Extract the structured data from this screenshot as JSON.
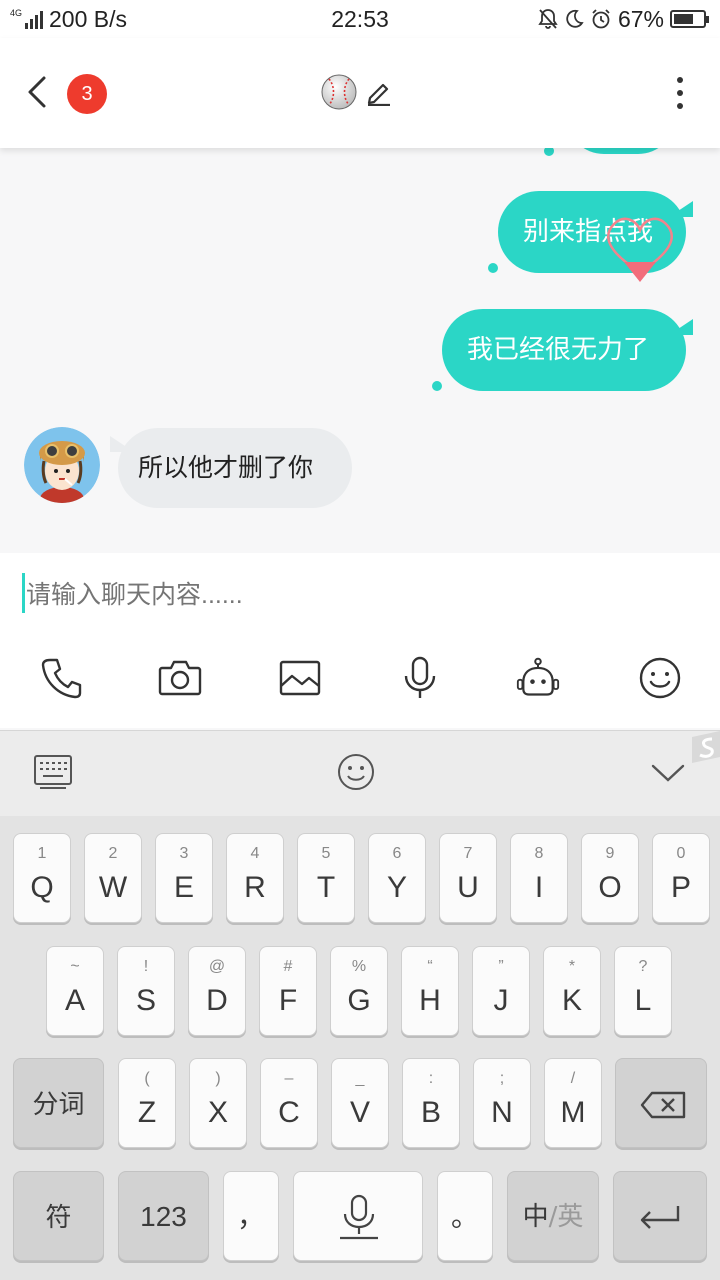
{
  "status_bar": {
    "network": "4G",
    "speed": "200 B/s",
    "time": "22:53",
    "battery": "67%",
    "battery_level": 0.67
  },
  "header": {
    "unread_count": "3"
  },
  "messages": [
    {
      "side": "out",
      "text": "别来指点我"
    },
    {
      "side": "out",
      "text": "我已经很无力了"
    },
    {
      "side": "in",
      "text": "所以他才删了你"
    }
  ],
  "input": {
    "placeholder": "请输入聊天内容......"
  },
  "toolbar": [
    "phone-icon",
    "camera-icon",
    "image-icon",
    "microphone-icon",
    "robot-icon",
    "emoji-icon"
  ],
  "keyboard": {
    "row1": [
      {
        "sub": "1",
        "key": "Q"
      },
      {
        "sub": "2",
        "key": "W"
      },
      {
        "sub": "3",
        "key": "E"
      },
      {
        "sub": "4",
        "key": "R"
      },
      {
        "sub": "5",
        "key": "T"
      },
      {
        "sub": "6",
        "key": "Y"
      },
      {
        "sub": "7",
        "key": "U"
      },
      {
        "sub": "8",
        "key": "I"
      },
      {
        "sub": "9",
        "key": "O"
      },
      {
        "sub": "0",
        "key": "P"
      }
    ],
    "row2": [
      {
        "sub": "~",
        "key": "A"
      },
      {
        "sub": "!",
        "key": "S"
      },
      {
        "sub": "@",
        "key": "D"
      },
      {
        "sub": "#",
        "key": "F"
      },
      {
        "sub": "%",
        "key": "G"
      },
      {
        "sub": "“",
        "key": "H"
      },
      {
        "sub": "”",
        "key": "J"
      },
      {
        "sub": "*",
        "key": "K"
      },
      {
        "sub": "?",
        "key": "L"
      }
    ],
    "row3": [
      {
        "sub": "(",
        "key": "Z"
      },
      {
        "sub": ")",
        "key": "X"
      },
      {
        "sub": "–",
        "key": "C"
      },
      {
        "sub": "_",
        "key": "V"
      },
      {
        "sub": ":",
        "key": "B"
      },
      {
        "sub": ";",
        "key": "N"
      },
      {
        "sub": "/",
        "key": "M"
      }
    ],
    "segment_label": "分词",
    "symbol_label": "符",
    "numbers_label": "123",
    "comma_label": "，",
    "period_label": "。",
    "lang_cn": "中",
    "lang_sep": "/",
    "lang_en": "英"
  },
  "colors": {
    "accent": "#2bd6c6",
    "badge": "#ee3b2d",
    "incoming_bubble": "#eaecee"
  }
}
